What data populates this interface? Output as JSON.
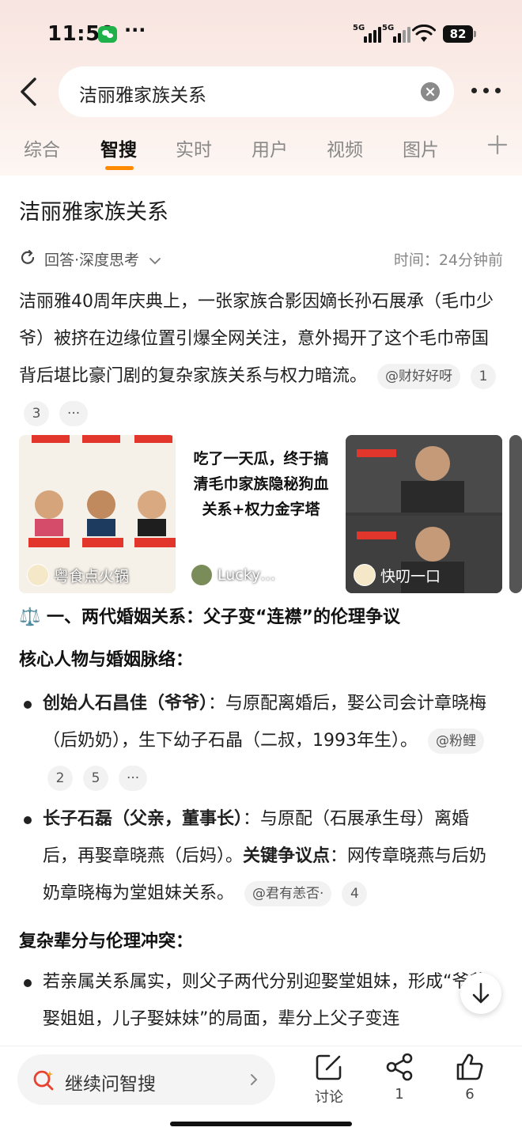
{
  "status_bar": {
    "time": "11:50",
    "dots": "···",
    "signal1": "5G",
    "signal2": "5G",
    "battery": "82"
  },
  "search": {
    "query": "洁丽雅家族关系"
  },
  "tabs": [
    {
      "label": "综合"
    },
    {
      "label": "智搜"
    },
    {
      "label": "实时"
    },
    {
      "label": "用户"
    },
    {
      "label": "视频"
    },
    {
      "label": "图片"
    }
  ],
  "answer": {
    "title": "洁丽雅家族关系",
    "meta_left": "回答·深度思考",
    "meta_right": "时间：24分钟前",
    "intro": "洁丽雅40周年庆典上，一张家族合影因嫡长孙石展承（毛巾少爷）被挤在边缘位置引爆全网关注，意外揭开了这个毛巾帝国背后堪比豪门剧的复杂家族关系与权力暗流。",
    "intro_chips": [
      "@财好好呀",
      "1",
      "3",
      "···"
    ],
    "thumbs": [
      {
        "label": "粤食点火锅"
      },
      {
        "label": "Lucky…"
      },
      {
        "label": "快叨一口"
      }
    ],
    "thumb2_text": "吃了一天瓜，终于搞清毛巾家族隐秘狗血关系+权力金字塔",
    "section1": "⚖️ 一、两代婚姻关系：父子变“连襟”的伦理争议",
    "sub1": "核心人物与婚姻脉络：",
    "bullet1": {
      "bold": "创始人石昌佳（爷爷）",
      "text": "：与原配离婚后，娶公司会计章晓梅（后奶奶），生下幼子石晶（二叔，1993年生）。",
      "chips": [
        "@粉鲤",
        "2",
        "5",
        "···"
      ]
    },
    "bullet2": {
      "bold": "长子石磊（父亲，董事长）",
      "text": "：与原配（石展承生母）离婚后，再娶章晓燕（后妈）。",
      "bold2": "关键争议点",
      "text2": "：网传章晓燕与后奶奶章晓梅为堂姐妹关系。",
      "chips": [
        "@君有恙否·",
        "4"
      ]
    },
    "sub2": "复杂辈分与伦理冲突：",
    "bullet3": {
      "text": "若亲属关系属实，则父子两代分别迎娶堂姐妹，形成“爷爷娶姐姐，儿子娶妹妹”的局面，辈分上父子变连"
    }
  },
  "bottom": {
    "ask": "继续问智搜",
    "actions": [
      {
        "icon": "edit-icon",
        "label": "讨论"
      },
      {
        "icon": "share-icon",
        "label": "1"
      },
      {
        "icon": "thumbs-up-icon",
        "label": "6"
      }
    ]
  },
  "colors": {
    "accent": "#ff8a00",
    "top_gradient": "#f8e4e0"
  }
}
